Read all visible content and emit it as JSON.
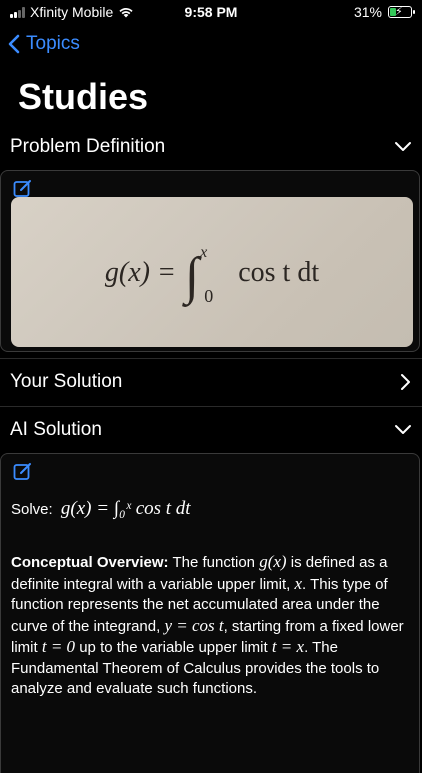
{
  "status_bar": {
    "carrier": "Xfinity Mobile",
    "time": "9:58 PM",
    "battery": "31%",
    "battery_level": 0.31
  },
  "nav": {
    "back_label": "Topics"
  },
  "page": {
    "title": "Studies"
  },
  "sections": {
    "problem": {
      "label": "Problem Definition",
      "image_formula_lhs": "g(x) =",
      "image_formula_upper": "x",
      "image_formula_lower": "0",
      "image_formula_rhs": "cos t dt"
    },
    "your_solution": {
      "label": "Your Solution"
    },
    "ai_solution": {
      "label": "AI Solution",
      "solve_prefix": "Solve:",
      "solve_formula": "g(x) = ∫₀ˣ cos t dt",
      "overview_heading": "Conceptual Overview:",
      "overview_text_1": "The function",
      "overview_math_1": "g(x)",
      "overview_text_2": "is defined as a definite integral with a variable upper limit,",
      "overview_math_2": "x",
      "overview_text_3": ". This type of function represents the net accumulated area under the curve of the integrand,",
      "overview_math_3": "y = cos t",
      "overview_text_4": ", starting from a fixed lower limit",
      "overview_math_4": "t = 0",
      "overview_text_5": "up to the variable upper limit",
      "overview_math_5": "t = x",
      "overview_text_6": ". The Fundamental Theorem of Calculus provides the tools to analyze and evaluate such functions."
    }
  },
  "colors": {
    "accent": "#3b8cff",
    "background": "#000000",
    "battery_fill": "#34c759"
  }
}
